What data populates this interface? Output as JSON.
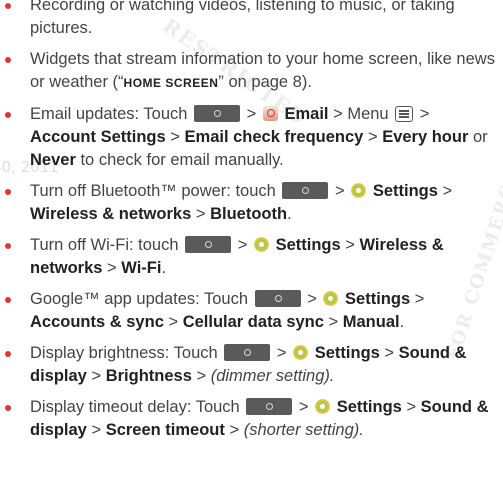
{
  "watermark": {
    "text_top": "RESTRICTED",
    "text_right": "FOR COMMERCIAL USE ONLY",
    "date": "30, 2011"
  },
  "bullets": [
    {
      "id": "b1",
      "parts": [
        "Recording or watching videos, listening to music, or taking pictures."
      ]
    },
    {
      "id": "b2",
      "parts": [
        "Widgets that stream information to your home screen, like news or weather (“",
        "HOME SCREEN",
        "” on page 8)."
      ]
    },
    {
      "id": "b3",
      "parts": [
        "Email updates: Touch",
        ">",
        "Email",
        "> Menu",
        ">",
        "Account Settings",
        ">",
        "Email check frequency",
        ">",
        "Every hour",
        "or",
        "Never",
        "to check for email manually."
      ]
    },
    {
      "id": "b4",
      "parts": [
        "Turn off Bluetooth™ power: touch",
        ">",
        "Settings",
        ">",
        "Wireless & networks",
        ">",
        "Bluetooth",
        "."
      ]
    },
    {
      "id": "b5",
      "parts": [
        "Turn off Wi-Fi: touch",
        ">",
        "Settings",
        ">",
        "Wireless & networks",
        ">",
        "Wi-Fi",
        "."
      ]
    },
    {
      "id": "b6",
      "parts": [
        "Google™ app updates: Touch",
        ">",
        "Settings",
        ">",
        "Accounts & sync",
        ">",
        "Cellular data sync",
        ">",
        "Manual",
        "."
      ]
    },
    {
      "id": "b7",
      "parts": [
        "Display brightness: Touch",
        ">",
        "Settings",
        ">",
        "Sound & display",
        ">",
        "Brightness",
        ">",
        "(dimmer setting)."
      ]
    },
    {
      "id": "b8",
      "parts": [
        "Display timeout delay: Touch",
        ">",
        "Settings",
        ">",
        "Sound & display",
        ">",
        "Screen timeout",
        ">",
        "(shorter setting)."
      ]
    }
  ],
  "colors": {
    "bullet": "#e0362b",
    "text": "#444444",
    "bold": "#222222"
  },
  "icons": [
    "home-button-icon",
    "email-app-icon",
    "menu-key-icon",
    "settings-gear-icon"
  ]
}
